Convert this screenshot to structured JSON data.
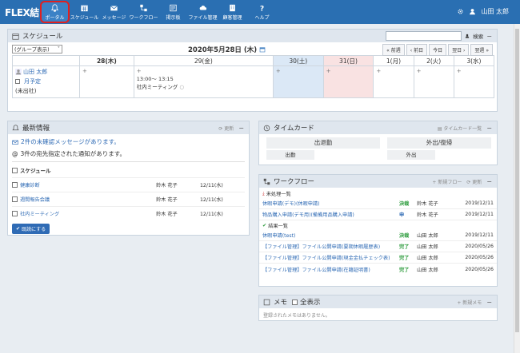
{
  "app": {
    "logo": "FLEX結",
    "user_name": "山田 太郎"
  },
  "nav": [
    {
      "label": "ポータル",
      "icon": "bell-icon",
      "active": true
    },
    {
      "label": "スケジュール",
      "icon": "calendar-icon"
    },
    {
      "label": "メッセージ",
      "icon": "envelope-icon"
    },
    {
      "label": "ワークフロー",
      "icon": "workflow-icon"
    },
    {
      "label": "掲示板",
      "icon": "board-icon"
    },
    {
      "label": "ファイル管理",
      "icon": "cloud-icon"
    },
    {
      "label": "顧客管理",
      "icon": "building-icon"
    },
    {
      "label": "ヘルプ",
      "icon": "help-icon"
    }
  ],
  "schedule": {
    "title": "スケジュール",
    "search_label": "検索",
    "group_select": "(グループ表示)",
    "date": "2020年5月28日 (木)",
    "nav_buttons": [
      "« 前週",
      "‹ 前日",
      "今日",
      "翌日 ›",
      "翌週 »"
    ],
    "days": [
      {
        "label": "28(木)",
        "type": "today"
      },
      {
        "label": "29(金)",
        "type": "weekday"
      },
      {
        "label": "30(土)",
        "type": "sat"
      },
      {
        "label": "31(日)",
        "type": "sun"
      },
      {
        "label": "1(月)",
        "type": "weekday"
      },
      {
        "label": "2(火)",
        "type": "weekday"
      },
      {
        "label": "3(水)",
        "type": "weekday"
      }
    ],
    "user": {
      "name": "山田 太郎",
      "month_plan": "月予定",
      "status": "(未出社)"
    },
    "event": {
      "time": "13:00～ 13:15",
      "title": "社内ミーティング"
    }
  },
  "news": {
    "title": "最新情報",
    "update_label": "更新",
    "unread_msg": "2件の未確認メッセージがあります。",
    "notice": "3件の宛先指定された通知があります。",
    "section_title": "スケジュール",
    "items": [
      {
        "title": "健康診断",
        "user": "鈴木 花子",
        "date": "12/11(水)"
      },
      {
        "title": "週間報告会議",
        "user": "鈴木 花子",
        "date": "12/11(水)"
      },
      {
        "title": "社内ミーティング",
        "user": "鈴木 花子",
        "date": "12/11(水)"
      }
    ],
    "mark_read_label": "既読にする"
  },
  "timecard": {
    "title": "タイムカード",
    "list_label": "タイムカード一覧",
    "buttons": [
      "出退勤",
      "外出/復帰",
      "出勤",
      "外出"
    ]
  },
  "workflow": {
    "title": "ワークフロー",
    "new_label": "新規フロー",
    "update_label": "更新",
    "pending_title": "未処理一覧",
    "pending": [
      {
        "title": "休暇申請(デモ)(休暇申請)",
        "status": "決裁",
        "user": "鈴木 花子",
        "date": "2019/12/11"
      },
      {
        "title": "物品購入申請(デモ用)(備備用品購入申請)",
        "status": "申",
        "user": "鈴木 花子",
        "date": "2019/12/11"
      }
    ],
    "done_title": "結果一覧",
    "done": [
      {
        "title": "休暇申請(test)",
        "status": "決裁",
        "user": "山田 太郎",
        "date": "2019/12/11"
      },
      {
        "title": "【ファイル管理】ファイル公開申請(要期休暇履歴表)",
        "status": "完了",
        "user": "山田 太郎",
        "date": "2020/05/26"
      },
      {
        "title": "【ファイル管理】ファイル公開申請(現金金払チェック表)",
        "status": "完了",
        "user": "山田 太郎",
        "date": "2020/05/26"
      },
      {
        "title": "【ファイル管理】ファイル公開申請(在籍証明書)",
        "status": "完了",
        "user": "山田 太郎",
        "date": "2020/05/26"
      }
    ]
  },
  "memo": {
    "title": "メモ",
    "show_all": "全表示",
    "new_label": "新規メモ",
    "empty": "登録されたメモはありません。"
  },
  "colors": {
    "header": "#2a6fb2",
    "panel_head": "#dfe6ee",
    "sat": "#dbe8f6",
    "sun": "#f9e2e2",
    "accent": "#2f6bb5"
  }
}
